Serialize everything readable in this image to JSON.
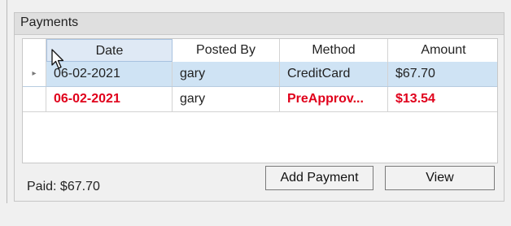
{
  "panel": {
    "title": "Payments"
  },
  "grid": {
    "columns": [
      "Date",
      "Posted By",
      "Method",
      "Amount"
    ],
    "rows": [
      {
        "date": "06-02-2021",
        "posted_by": "gary",
        "method": "CreditCard",
        "amount": "$67.70",
        "selected": true,
        "row_marker": "▸"
      },
      {
        "date": "06-02-2021",
        "posted_by": "gary",
        "method": "PreApprov...",
        "amount": "$13.54",
        "highlight_color": "#e0001b"
      }
    ]
  },
  "footer": {
    "paid_label": "Paid:",
    "paid_value": "$67.70",
    "add_payment_label": "Add Payment",
    "view_label": "View"
  }
}
